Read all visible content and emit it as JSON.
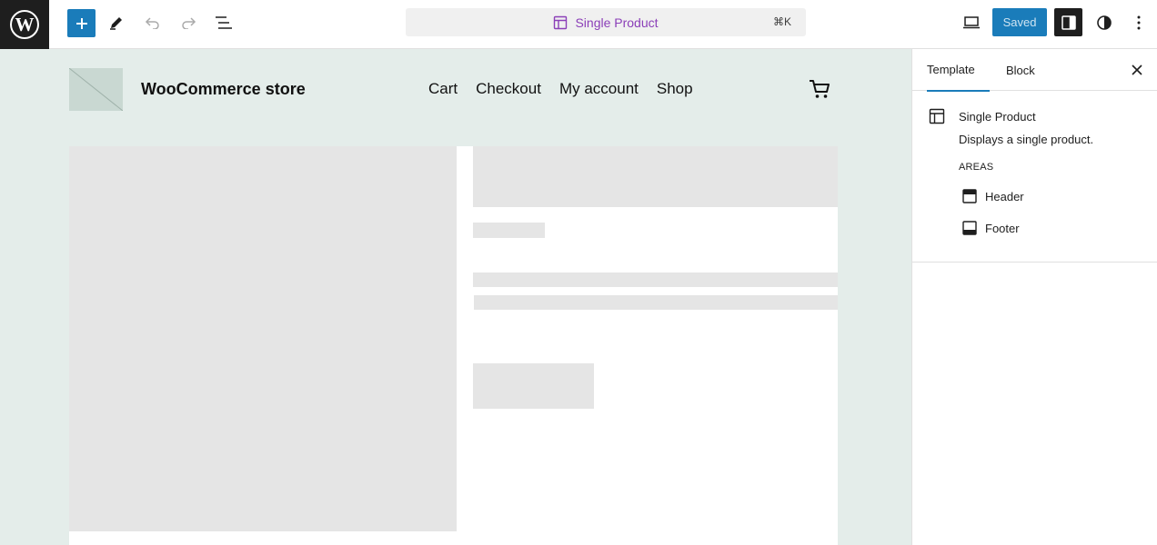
{
  "toolbar": {
    "logo_icon": "wordpress-logo",
    "add_label": "+",
    "command": {
      "icon": "layout-template-icon",
      "label": "Single Product",
      "shortcut": "⌘K"
    },
    "saved_label": "Saved",
    "accent_color": "#1a7cba"
  },
  "site": {
    "title": "WooCommerce store",
    "nav": [
      "Cart",
      "Checkout",
      "My account",
      "Shop"
    ],
    "cart_icon": "cart-icon",
    "background": "#e4edea"
  },
  "sidebar": {
    "tabs": [
      "Template",
      "Block"
    ],
    "template": {
      "title": "Single Product",
      "description": "Displays a single product.",
      "areas_heading": "AREAS",
      "areas": [
        {
          "label": "Header",
          "icon": "header-area-icon"
        },
        {
          "label": "Footer",
          "icon": "footer-area-icon"
        }
      ]
    }
  }
}
